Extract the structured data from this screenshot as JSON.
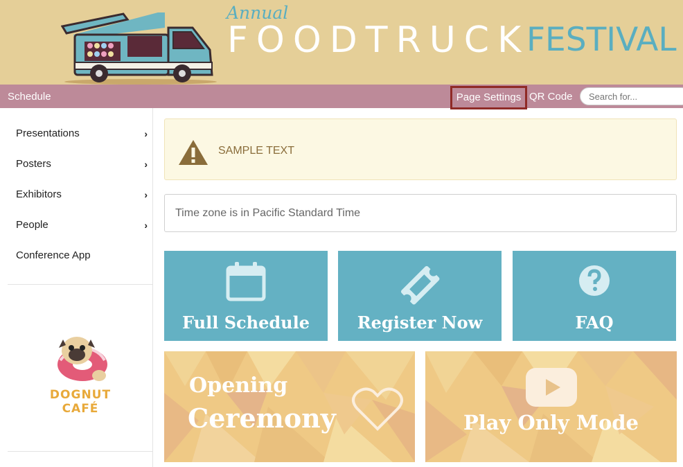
{
  "banner": {
    "annual": "Annual",
    "title_main": "FOODTRUCK",
    "title_accent": "FESTIVAL"
  },
  "nav": {
    "schedule": "Schedule",
    "page_settings": "Page Settings",
    "qr_code": "QR Code",
    "search_placeholder": "Search for..."
  },
  "sidebar": {
    "items": [
      {
        "label": "Presentations",
        "has_chevron": true
      },
      {
        "label": "Posters",
        "has_chevron": true
      },
      {
        "label": "Exhibitors",
        "has_chevron": true
      },
      {
        "label": "People",
        "has_chevron": true
      },
      {
        "label": "Conference App",
        "has_chevron": false
      }
    ],
    "chevron": "›",
    "sponsor_logo_text": "DOGNUT CAFÉ"
  },
  "alert": {
    "icon": "warning-icon",
    "text": "SAMPLE TEXT"
  },
  "timezone": "Time zone is in Pacific Standard Time",
  "tiles": [
    {
      "label": "Full Schedule",
      "icon": "calendar-icon"
    },
    {
      "label": "Register Now",
      "icon": "ticket-icon"
    },
    {
      "label": "FAQ",
      "icon": "question-icon"
    }
  ],
  "panels": {
    "opening_line1": "Opening",
    "opening_line2": "Ceremony",
    "play_only": "Play Only Mode"
  },
  "colors": {
    "banner_bg": "#e5cf98",
    "navbar_bg": "#bd8a99",
    "tile_bg": "#64b1c3",
    "accent_blue": "#5aaec0",
    "highlight_border": "#8f2a26"
  }
}
